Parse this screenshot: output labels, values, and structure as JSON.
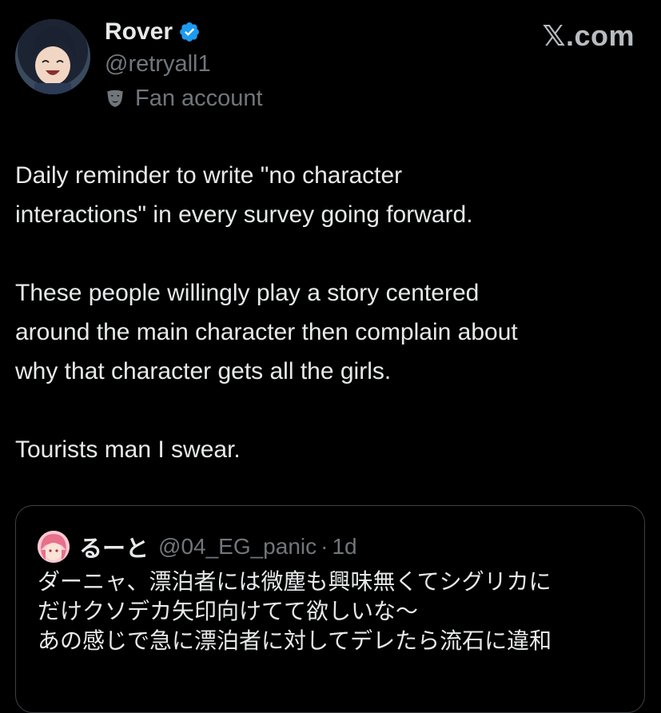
{
  "author": {
    "display_name": "Rover",
    "handle": "@retryall1",
    "account_label": "Fan account",
    "verified": true,
    "avatar_icon": "anime-avatar",
    "label_icon": "theater-mask-icon"
  },
  "brand": {
    "text": "𝕏.com"
  },
  "tweet": {
    "paragraphs": [
      "Daily reminder to write \"no character\ninteractions\" in every survey going forward.",
      "These people willingly play a story centered\naround the main character then complain about\nwhy that character gets all the girls.",
      "Tourists man I swear."
    ]
  },
  "quote": {
    "display_name": "るーと",
    "handle": "@04_EG_panic",
    "separator": "·",
    "time": "1d",
    "lines": [
      "ダーニャ、漂泊者には微塵も興味無くてシグリカに",
      "だけクソデカ矢印向けてて欲しいな～",
      "あの感じで急に漂泊者に対してデレたら流石に違和"
    ]
  },
  "colors": {
    "background": "#000000",
    "primary_text": "#e7e9ea",
    "secondary_text": "#71767b",
    "verified_blue": "#1d9bf0",
    "card_border": "#3e4144"
  }
}
